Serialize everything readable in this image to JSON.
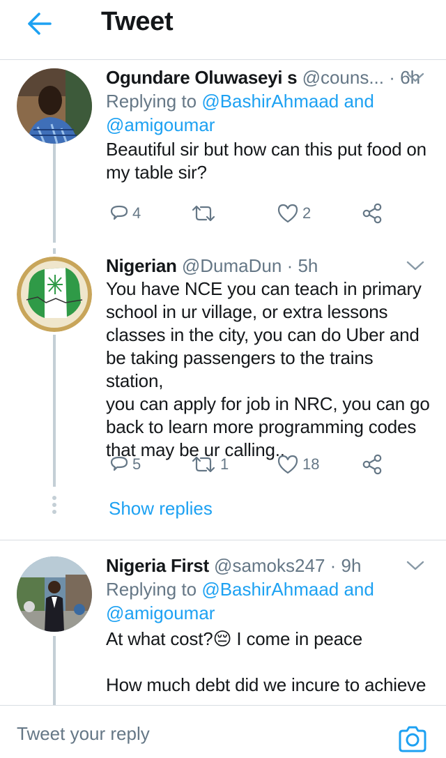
{
  "header": {
    "title": "Tweet"
  },
  "colors": {
    "accent": "#1da1f2",
    "text": "#14171a",
    "muted": "#657786",
    "divider": "#d8dde2"
  },
  "tweets": [
    {
      "name": "Ogundare Oluwaseyi s",
      "handle": "@couns...",
      "time": "6h",
      "replying_prefix": "Replying to ",
      "replying_to": "@BashirAhmaad and",
      "replying_to_2": "@amigoumar",
      "text_lines": [
        "Beautiful sir but how can this put food on",
        "my table sir?"
      ],
      "replies": "4",
      "retweets": "",
      "likes": "2"
    },
    {
      "name": "Nigerian",
      "handle": "@DumaDun",
      "time": "5h",
      "text_lines": [
        "You have NCE you can teach in primary",
        "school in ur village, or extra lessons",
        "classes in the city, you can do Uber and",
        "be taking passengers to the trains station,",
        "you can apply for job in NRC, you can go",
        "back to learn more programming codes",
        "that may be ur calling.."
      ],
      "replies": "5",
      "retweets": "1",
      "likes": "18",
      "show_replies": "Show replies"
    },
    {
      "name": "Nigeria First",
      "handle": "@samoks247",
      "time": "9h",
      "replying_prefix": "Replying to ",
      "replying_to": "@BashirAhmaad and",
      "replying_to_2": "@amigoumar",
      "text_line_1a": "At what cost?",
      "emoji": "😔",
      "text_line_1b": " I come in peace",
      "text_line_2": "How much debt did we incure to achieve"
    }
  ],
  "reply_bar": {
    "placeholder": "Tweet your reply"
  },
  "icons": {
    "back": "back-arrow-icon",
    "caret": "chevron-down-icon",
    "reply": "reply-icon",
    "retweet": "retweet-icon",
    "like": "heart-icon",
    "share": "share-icon",
    "camera": "camera-icon"
  }
}
